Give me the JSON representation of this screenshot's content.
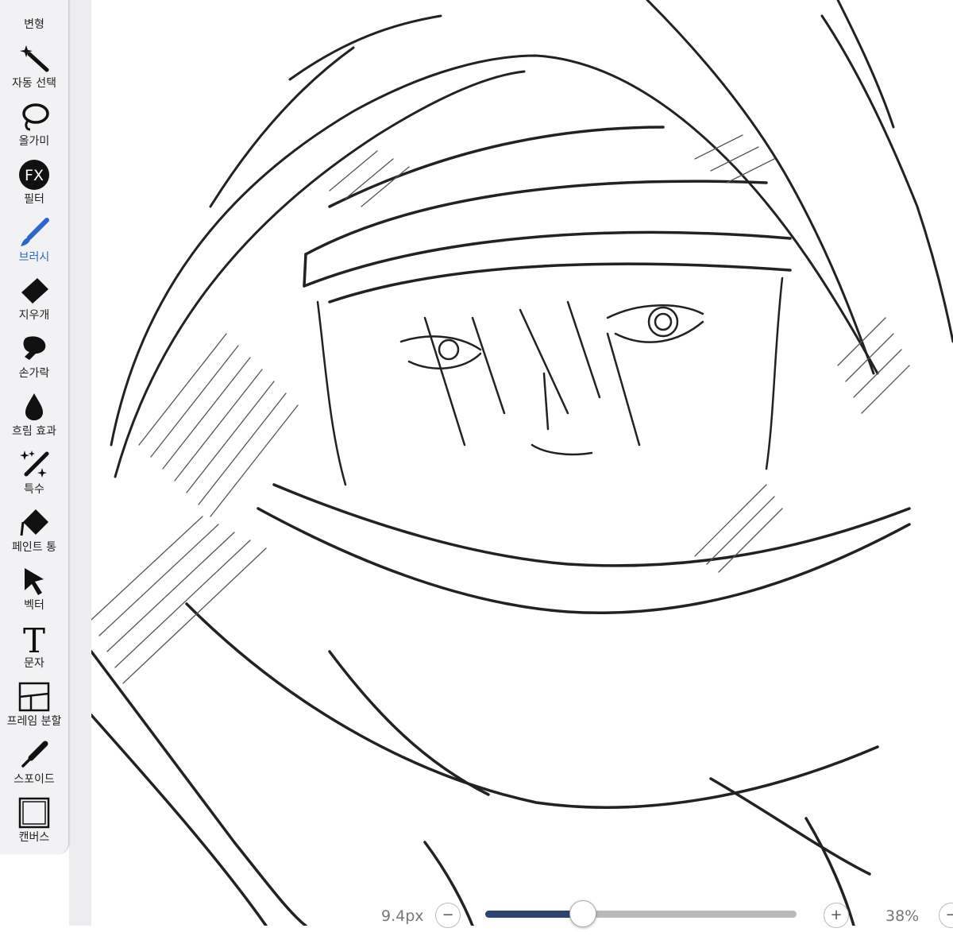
{
  "toolbar": {
    "tools": [
      {
        "label": "변형",
        "icon": "transform-icon",
        "active": false
      },
      {
        "label": "자동 선택",
        "icon": "magic-wand-icon",
        "active": false
      },
      {
        "label": "올가미",
        "icon": "lasso-icon",
        "active": false
      },
      {
        "label": "필터",
        "icon": "filter-fx-icon",
        "icon_text": "FX",
        "active": false
      },
      {
        "label": "브러시",
        "icon": "brush-icon",
        "active": true
      },
      {
        "label": "지우개",
        "icon": "eraser-icon",
        "active": false
      },
      {
        "label": "손가락",
        "icon": "smudge-finger-icon",
        "active": false
      },
      {
        "label": "흐림 효과",
        "icon": "blur-drop-icon",
        "active": false
      },
      {
        "label": "특수",
        "icon": "special-sparkle-icon",
        "active": false
      },
      {
        "label": "페인트 통",
        "icon": "paint-bucket-icon",
        "active": false
      },
      {
        "label": "벡터",
        "icon": "vector-arrow-icon",
        "active": false
      },
      {
        "label": "문자",
        "icon": "text-icon",
        "icon_text": "T",
        "active": false
      },
      {
        "label": "프레임 분할",
        "icon": "frame-divider-icon",
        "active": false
      },
      {
        "label": "스포이드",
        "icon": "eyedropper-icon",
        "active": false
      },
      {
        "label": "캔버스",
        "icon": "canvas-icon",
        "active": false
      }
    ]
  },
  "canvas": {
    "content": "pencil-sketch-artwork"
  },
  "bottom_bar": {
    "brush_size": "9.4px",
    "minus": "−",
    "plus": "+",
    "slider_value": 0.31,
    "zoom": "38%",
    "accent_color": "#2c4470"
  },
  "colors": {
    "active_tool": "#2a66c9",
    "toolbar_bg": "#f2f2f4"
  }
}
